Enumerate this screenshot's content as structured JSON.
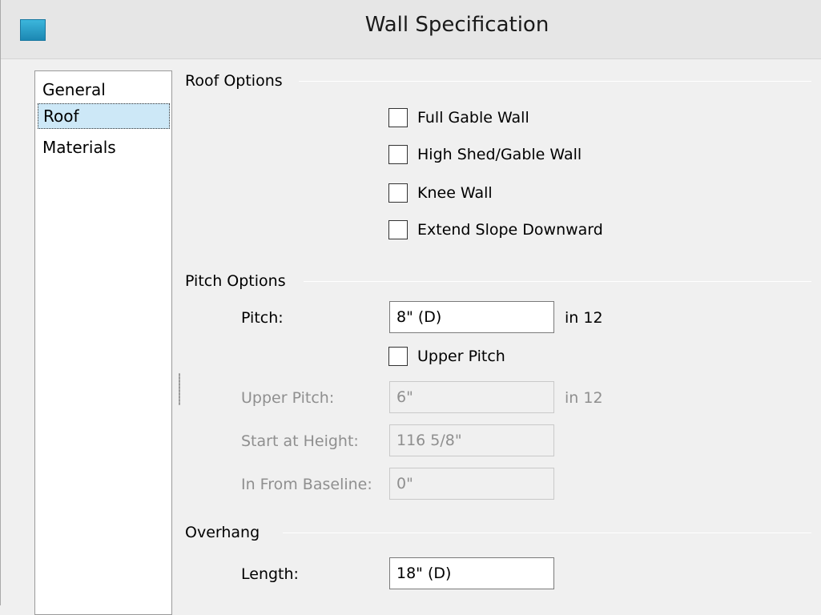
{
  "window": {
    "title": "Wall Specification",
    "app_icon": "chief-architect-app-icon"
  },
  "nav": {
    "items": [
      {
        "label": "General",
        "selected": false
      },
      {
        "label": "Roof",
        "selected": true
      },
      {
        "label": "Materials",
        "selected": false
      }
    ]
  },
  "roof_options": {
    "heading": "Roof Options",
    "checkboxes": [
      {
        "label": "Full Gable Wall",
        "checked": false
      },
      {
        "label": "High Shed/Gable Wall",
        "checked": false
      },
      {
        "label": "Knee Wall",
        "checked": false
      },
      {
        "label": "Extend Slope Downward",
        "checked": false
      }
    ]
  },
  "pitch_options": {
    "heading": "Pitch Options",
    "pitch_label": "Pitch:",
    "pitch_value": "8\" (D)",
    "pitch_unit": "in 12",
    "upper_pitch_checkbox": {
      "label": "Upper Pitch",
      "checked": false
    },
    "upper_pitch_label": "Upper Pitch:",
    "upper_pitch_value": "6\"",
    "upper_pitch_unit": "in 12",
    "start_height_label": "Start at Height:",
    "start_height_value": "116 5/8\"",
    "in_from_baseline_label": "In From Baseline:",
    "in_from_baseline_value": "0\""
  },
  "overhang": {
    "heading": "Overhang",
    "length_label": "Length:",
    "length_value": "18\" (D)"
  }
}
